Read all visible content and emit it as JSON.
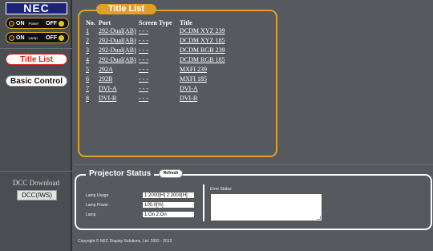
{
  "brand": {
    "logo_text": "NEC"
  },
  "power_toggle": {
    "on_label": "ON",
    "type_label": "Power",
    "off_label": "OFF"
  },
  "lamp_toggle": {
    "on_label": "ON",
    "type_label": "Lamp",
    "off_label": "OFF"
  },
  "nav": {
    "title_list": "Title List",
    "basic_control": "Basic Control"
  },
  "dcc": {
    "label": "DCC Download",
    "button": "DCC(IWS)"
  },
  "title_list": {
    "tab_label": "Title List",
    "headers": {
      "no": "No.",
      "port": "Port",
      "screen_type": "Screen Type",
      "title": "Title"
    },
    "rows": [
      {
        "no": "1",
        "port": "292-Dual(AB)",
        "screen_type": "- - -",
        "title": "DCDM XYZ 239"
      },
      {
        "no": "2",
        "port": "292-Dual(AB)",
        "screen_type": "- - -",
        "title": "DCDM XYZ 185"
      },
      {
        "no": "3",
        "port": "292-Dual(AB)",
        "screen_type": "- - -",
        "title": "DCDM RGB 239"
      },
      {
        "no": "4",
        "port": "292-Dual(AB)",
        "screen_type": "- - -",
        "title": "DCDM RGB 185"
      },
      {
        "no": "5",
        "port": "292A",
        "screen_type": "- - -",
        "title": "MXFI 239"
      },
      {
        "no": "6",
        "port": "292B",
        "screen_type": "- - -",
        "title": "MXFI 185"
      },
      {
        "no": "7",
        "port": "DVI-A",
        "screen_type": "- - -",
        "title": "DVI-A"
      },
      {
        "no": "8",
        "port": "DVI-B",
        "screen_type": "- - -",
        "title": "DVI-B"
      }
    ]
  },
  "projector_status": {
    "tab_label": "Projector Status",
    "refresh_label": "Refresh",
    "lamp_usage_label": "Lamp Usage",
    "lamp_usage_value": "1:2000[H] 2:2000[H]",
    "lamp_power_label": "Lamp Power",
    "lamp_power_value": "100.0[%]",
    "lamp_label": "Lamp",
    "lamp_value": "1:On 2:On",
    "error_status_label": "Error Status",
    "error_status_value": ""
  },
  "footer": {
    "copyright": "Copyright © NEC Display Solutions, Ltd. 2002 - 2012"
  },
  "colors": {
    "accent": "#e0a028",
    "background": "#56595e",
    "active_nav_text": "#d9261c",
    "logo_bg": "#1d2478"
  }
}
